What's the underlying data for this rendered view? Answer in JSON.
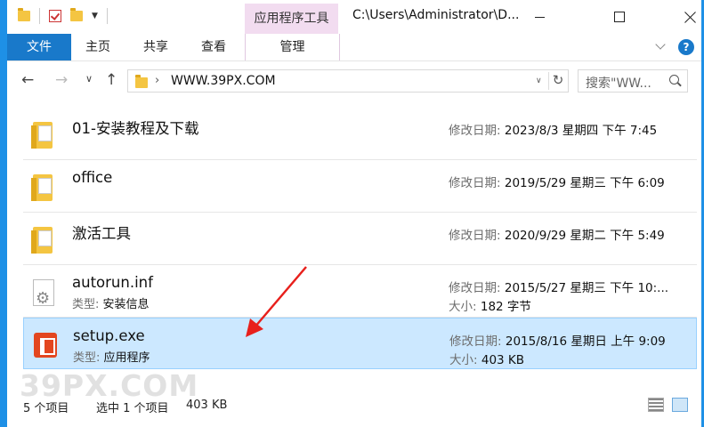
{
  "titlebar": {
    "context_tab": "应用程序工具",
    "title": "C:\\Users\\Administrator\\D..."
  },
  "ribbon": {
    "file": "文件",
    "home": "主页",
    "share": "共享",
    "view": "查看",
    "manage": "管理",
    "help": "?"
  },
  "address": {
    "path": "WWW.39PX.COM",
    "search_placeholder": "搜索\"WW..."
  },
  "labels": {
    "modified": "修改日期:",
    "type": "类型:",
    "size": "大小:"
  },
  "items": [
    {
      "name": "01-安装教程及下载",
      "modified": "2023/8/3 星期四 下午 7:45"
    },
    {
      "name": "office",
      "modified": "2019/5/29 星期三 下午 6:09"
    },
    {
      "name": "激活工具",
      "modified": "2020/9/29 星期二 下午 5:49"
    },
    {
      "name": "autorun.inf",
      "type": "安装信息",
      "modified": "2015/5/27 星期三 下午 10:...",
      "size": "182 字节"
    },
    {
      "name": "setup.exe",
      "type": "应用程序",
      "modified": "2015/8/16 星期日 上午 9:09",
      "size": "403 KB"
    }
  ],
  "status": {
    "count": "5 个项目",
    "selected": "选中 1 个项目",
    "size": "403 KB"
  },
  "watermark": "39PX.COM",
  "colors": {
    "accent": "#1e90e6",
    "file_tab": "#1979ca",
    "selected_row": "#cce8ff",
    "context_tab": "#f2dcf0",
    "annotation_arrow": "#e8201c"
  }
}
